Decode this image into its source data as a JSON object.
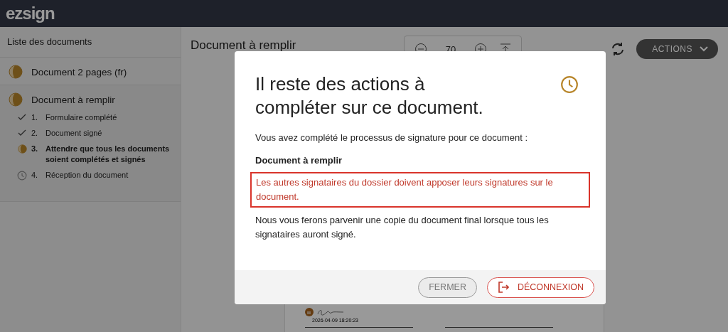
{
  "header": {
    "logo": "ezsign"
  },
  "sidebar": {
    "title": "Liste des documents",
    "documents": [
      {
        "name": "Document 2 pages (fr)",
        "selected": false
      },
      {
        "name": "Document à remplir",
        "selected": true,
        "steps": [
          {
            "number": "1.",
            "label": "Formulaire complété",
            "kind": "done"
          },
          {
            "number": "2.",
            "label": "Document signé",
            "kind": "done"
          },
          {
            "number": "3.",
            "label": "Attendre que tous les documents soient complétés et signés",
            "kind": "current"
          },
          {
            "number": "4.",
            "label": "Réception du document",
            "kind": "pending"
          }
        ]
      }
    ]
  },
  "main": {
    "title": "Document à remplir",
    "zoom": {
      "value": "70"
    },
    "actions_button": "ACTIONS",
    "signature": {
      "date": "2026-04-09 18:20:23"
    }
  },
  "modal": {
    "title": "Il reste des actions à compléter sur ce document.",
    "intro": "Vous avez complété le processus de signature pour ce document :",
    "document_name": "Document à remplir",
    "alert": "Les autres signataires du dossier doivent apposer leurs signatures sur le document.",
    "note": "Nous vous ferons parvenir une copie du document final lorsque tous les signataires auront signé.",
    "buttons": [
      {
        "label": "FERMER",
        "kind": "secondary"
      },
      {
        "label": "DÉCONNEXION",
        "kind": "logout"
      }
    ]
  }
}
